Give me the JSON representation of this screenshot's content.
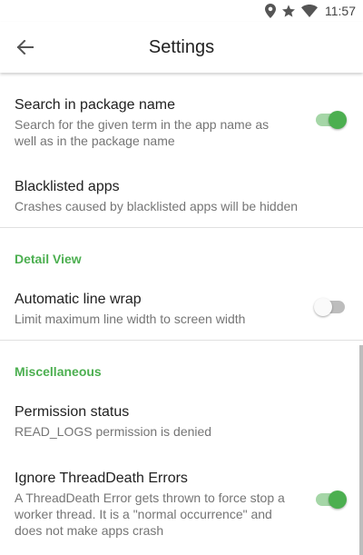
{
  "status_bar": {
    "icons": [
      "location-icon",
      "star-icon",
      "wifi-icon"
    ],
    "time": "11:57"
  },
  "app_bar": {
    "back_icon": "arrow-left-icon",
    "title": "Settings"
  },
  "preferences": {
    "search_package": {
      "title": "Search in package name",
      "summary": "Search for the given term in the app name as well as in the package name",
      "enabled": true
    },
    "blacklisted": {
      "title": "Blacklisted apps",
      "summary": "Crashes caused by blacklisted apps will be hidden"
    },
    "detail_view": {
      "header": "Detail View",
      "line_wrap": {
        "title": "Automatic line wrap",
        "summary": "Limit maximum line width to screen width",
        "enabled": false
      }
    },
    "misc": {
      "header": "Miscellaneous",
      "permission": {
        "title": "Permission status",
        "summary": "READ_LOGS permission is denied"
      },
      "threaddeath": {
        "title": "Ignore ThreadDeath Errors",
        "summary": "A ThreadDeath Error gets thrown to force stop a worker thread. It is a \"normal occurrence\" and does not make apps crash",
        "enabled": true
      }
    }
  },
  "colors": {
    "accent": "#4caf50",
    "accent_track": "#a5d6a7",
    "text_primary": "#212121",
    "text_secondary": "#757575"
  }
}
